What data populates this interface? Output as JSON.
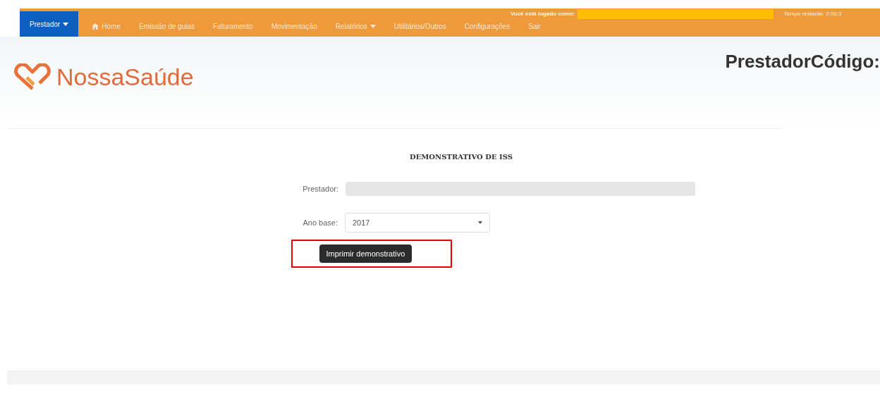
{
  "navbar": {
    "menu": [
      {
        "label": "Prestador",
        "kind": "dropdown",
        "selected": true
      },
      {
        "label": "Home",
        "kind": "home",
        "selected": false
      },
      {
        "label": "Emissão de guias",
        "kind": "link",
        "selected": false
      },
      {
        "label": "Faturamento",
        "kind": "link",
        "selected": false
      },
      {
        "label": "Movimentação",
        "kind": "link",
        "selected": false
      },
      {
        "label": "Relatórios",
        "kind": "dropdown",
        "selected": false
      },
      {
        "label": "Utilitários/Outros",
        "kind": "link",
        "selected": false
      },
      {
        "label": "Configurações",
        "kind": "link",
        "selected": false
      },
      {
        "label": "Sair",
        "kind": "link",
        "selected": false
      }
    ],
    "logged_in_label": "Você está logado como:",
    "session_timer": "Tempo restante: 2:00:3"
  },
  "header": {
    "logo_text": "NossaSaúde",
    "provider_code_label": "PrestadorCódigo:"
  },
  "form": {
    "title": "DEMONSTRATIVO DE ISS",
    "provider_label": "Prestador:",
    "year_label": "Ano base:",
    "year_value": "2017",
    "print_button": "Imprimir demonstrativo"
  }
}
